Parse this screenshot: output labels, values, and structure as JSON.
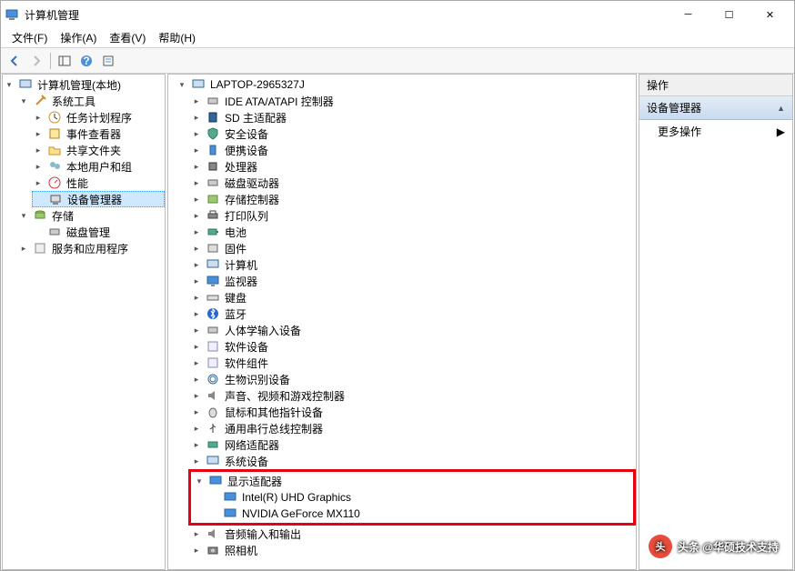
{
  "title": "计算机管理",
  "menu": {
    "file": "文件(F)",
    "action": "操作(A)",
    "view": "查看(V)",
    "help": "帮助(H)"
  },
  "leftTree": {
    "root": "计算机管理(本地)",
    "sysTools": "系统工具",
    "taskScheduler": "任务计划程序",
    "eventViewer": "事件查看器",
    "sharedFolders": "共享文件夹",
    "localUsers": "本地用户和组",
    "performance": "性能",
    "deviceManager": "设备管理器",
    "storage": "存储",
    "diskMgmt": "磁盘管理",
    "services": "服务和应用程序"
  },
  "deviceTree": {
    "root": "LAPTOP-2965327J",
    "ide": "IDE ATA/ATAPI 控制器",
    "sd": "SD 主适配器",
    "security": "安全设备",
    "portable": "便携设备",
    "cpu": "处理器",
    "diskDrives": "磁盘驱动器",
    "storageCtrl": "存储控制器",
    "printQueue": "打印队列",
    "battery": "电池",
    "firmware": "固件",
    "computer": "计算机",
    "monitor": "监视器",
    "keyboard": "键盘",
    "bluetooth": "蓝牙",
    "hid": "人体学输入设备",
    "swDevices": "软件设备",
    "swComponents": "软件组件",
    "biometric": "生物识别设备",
    "audioVideo": "声音、视频和游戏控制器",
    "mouse": "鼠标和其他指针设备",
    "usbCtrl": "通用串行总线控制器",
    "network": "网络适配器",
    "sysDevices": "系统设备",
    "display": "显示适配器",
    "intelGpu": "Intel(R) UHD Graphics",
    "nvidiaGpu": "NVIDIA GeForce MX110",
    "audioIO": "音频输入和输出",
    "camera": "照相机"
  },
  "rightPanel": {
    "header": "操作",
    "section": "设备管理器",
    "more": "更多操作"
  },
  "watermark": "头条 @华硕技术支持"
}
